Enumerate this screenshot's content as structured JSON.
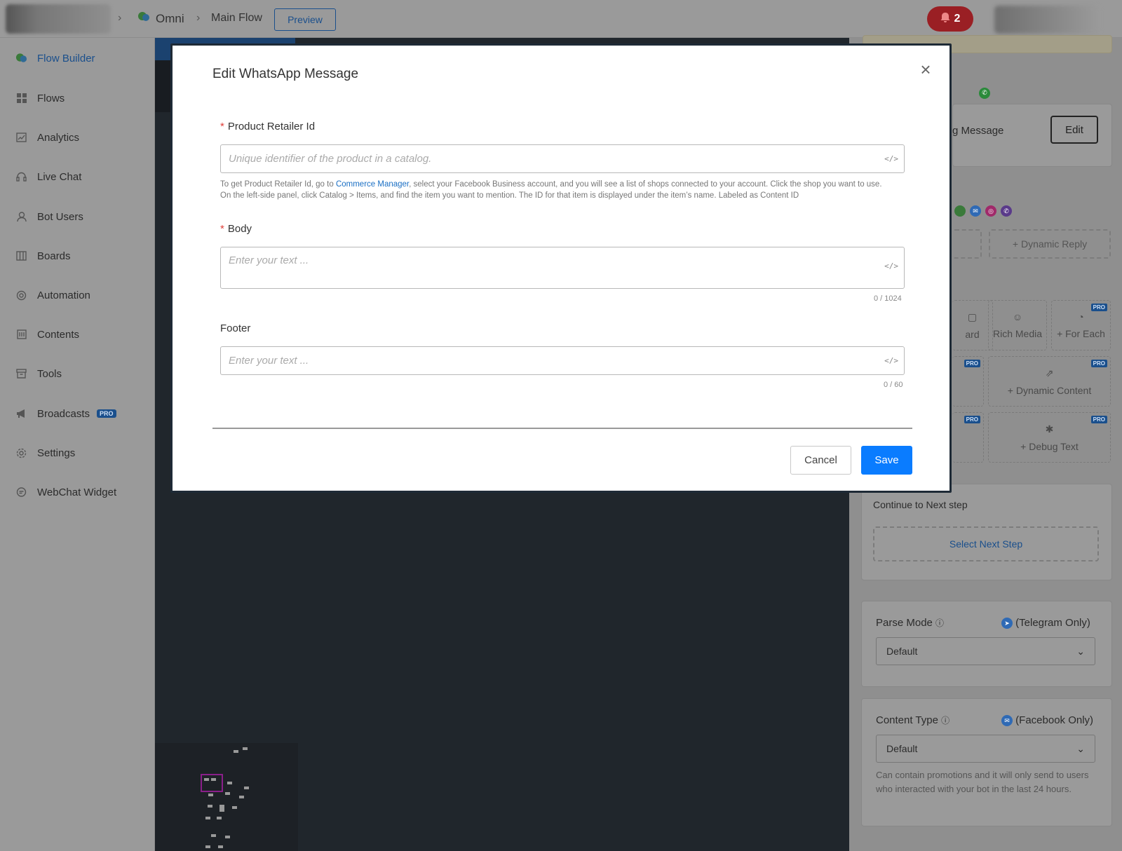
{
  "header": {
    "breadcrumb": [
      "Omni",
      "Main Flow"
    ],
    "preview_label": "Preview",
    "notification_count": "2"
  },
  "sidebar": {
    "items": [
      {
        "label": "Flow Builder",
        "icon": "flow-builder-icon",
        "active": true
      },
      {
        "label": "Flows",
        "icon": "grid-icon"
      },
      {
        "label": "Analytics",
        "icon": "chart-icon"
      },
      {
        "label": "Live Chat",
        "icon": "headset-icon"
      },
      {
        "label": "Bot Users",
        "icon": "user-icon"
      },
      {
        "label": "Boards",
        "icon": "board-icon"
      },
      {
        "label": "Automation",
        "icon": "automation-icon"
      },
      {
        "label": "Contents",
        "icon": "contents-icon"
      },
      {
        "label": "Tools",
        "icon": "toolbox-icon"
      },
      {
        "label": "Broadcasts",
        "icon": "megaphone-icon",
        "badge": "PRO"
      },
      {
        "label": "Settings",
        "icon": "gear-icon"
      },
      {
        "label": "WebChat Widget",
        "icon": "chat-bubble-icon"
      }
    ]
  },
  "right_panel": {
    "message_card_label": "g Message",
    "edit_label": "Edit",
    "dynamic_reply": "+ Dynamic Reply",
    "tiles": [
      {
        "label": "ard"
      },
      {
        "label": "Rich Media"
      },
      {
        "label": "+ For Each",
        "badge": "PRO"
      },
      {
        "label": "",
        "badge": "PRO"
      },
      {
        "label": "+ Dynamic Content",
        "badge": "PRO"
      },
      {
        "label": "",
        "badge": "PRO"
      },
      {
        "label": "+ Debug Text",
        "badge": "PRO"
      }
    ],
    "continue_label": "Continue to Next step",
    "select_next_step": "Select Next Step",
    "parse_mode": {
      "label": "Parse Mode",
      "platform": "(Telegram Only)",
      "value": "Default"
    },
    "content_type": {
      "label": "Content Type",
      "platform": "(Facebook Only)",
      "value": "Default",
      "help": "Can contain promotions and it will only send to users who interacted with your bot in the last 24 hours."
    }
  },
  "modal": {
    "title": "Edit WhatsApp Message",
    "product_retailer_id": {
      "label": "Product Retailer Id",
      "placeholder": "Unique identifier of the product in a catalog.",
      "help_before_link": "To get Product Retailer Id, go to ",
      "help_link": "Commerce Manager",
      "help_after_link": ", select your Facebook Business account, and you will see a list of shops connected to your account. Click the shop you want to use. On the left-side panel, click Catalog > Items, and find the item you want to mention. The ID for that item is displayed under the item’s name. Labeled as Content ID"
    },
    "body": {
      "label": "Body",
      "placeholder": "Enter your text ...",
      "counter": "0 / 1024"
    },
    "footer": {
      "label": "Footer",
      "placeholder": "Enter your text ...",
      "counter": "0 / 60"
    },
    "cancel_label": "Cancel",
    "save_label": "Save"
  },
  "colors": {
    "primary": "#0a7cff",
    "required": "#e0403a",
    "link": "#1a6fc4",
    "notification": "#9a1f24"
  }
}
